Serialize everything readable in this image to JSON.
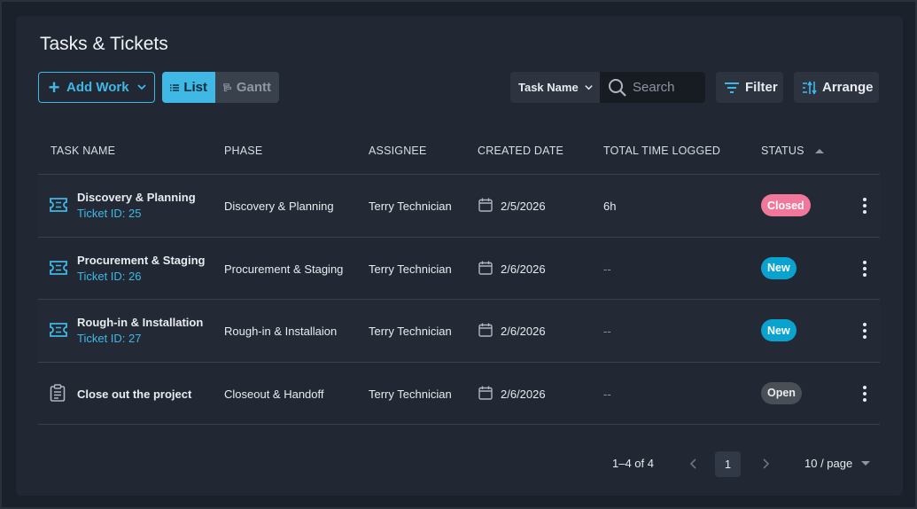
{
  "page": {
    "title": "Tasks & Tickets"
  },
  "toolbar": {
    "add_label": "Add Work",
    "views": [
      {
        "label": "List",
        "active": true
      },
      {
        "label": "Gantt",
        "active": false
      }
    ],
    "search_field_select": "Task Name",
    "search_placeholder": "Search",
    "filter_label": "Filter",
    "arrange_label": "Arrange"
  },
  "table": {
    "columns": [
      "TASK NAME",
      "PHASE",
      "ASSIGNEE",
      "CREATED DATE",
      "TOTAL TIME LOGGED",
      "STATUS"
    ],
    "sorted_column": "STATUS",
    "rows": [
      {
        "icon": "ticket-icon",
        "name": "Discovery & Planning",
        "ticket": "Ticket ID: 25",
        "phase": "Discovery & Planning",
        "assignee": "Terry Technician",
        "created": "2/5/2026",
        "time": "6h",
        "status": "Closed",
        "status_color": "#f1789b"
      },
      {
        "icon": "ticket-icon",
        "name": "Procurement & Staging",
        "ticket": "Ticket ID: 26",
        "phase": "Procurement & Staging",
        "assignee": "Terry Technician",
        "created": "2/6/2026",
        "time": "--",
        "status": "New",
        "status_color": "#0aa3cf"
      },
      {
        "icon": "ticket-icon",
        "name": "Rough-in & Installation",
        "ticket": "Ticket ID: 27",
        "phase": "Rough-in & Installaion",
        "assignee": "Terry Technician",
        "created": "2/6/2026",
        "time": "--",
        "status": "New",
        "status_color": "#0aa3cf"
      },
      {
        "icon": "clipboard-icon",
        "name": "Close out the project",
        "ticket": "",
        "phase": "Closeout & Handoff",
        "assignee": "Terry Technician",
        "created": "2/6/2026",
        "time": "--",
        "status": "Open",
        "status_color": "#4a4f57"
      }
    ]
  },
  "pagination": {
    "range": "1–4 of 4",
    "current_page": "1",
    "per_page": "10 / page"
  }
}
